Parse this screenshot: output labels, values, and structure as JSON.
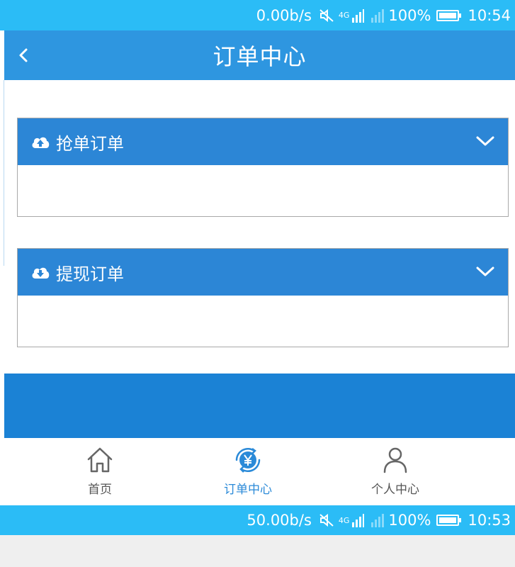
{
  "status_top": {
    "speed": "0.00b/s",
    "network": "4G",
    "battery": "100%",
    "time": "10:54"
  },
  "status_bottom": {
    "speed": "50.00b/s",
    "network": "4G",
    "battery": "100%",
    "time": "10:53"
  },
  "navbar": {
    "title": "订单中心",
    "back_icon": "chevron-left-icon"
  },
  "panels": [
    {
      "label": "抢单订单",
      "icon": "cloud-upload-icon"
    },
    {
      "label": "提现订单",
      "icon": "cloud-download-icon"
    }
  ],
  "tabs": [
    {
      "label": "首页",
      "icon": "home-icon"
    },
    {
      "label": "订单中心",
      "icon": "yen-refresh-icon",
      "active": true
    },
    {
      "label": "个人中心",
      "icon": "user-icon"
    }
  ],
  "colors": {
    "status": "#2bbcf6",
    "nav": "#2e96e0",
    "panel_head": "#2c86d6",
    "block": "#1b82d5",
    "active_tab": "#2b8ad8"
  }
}
